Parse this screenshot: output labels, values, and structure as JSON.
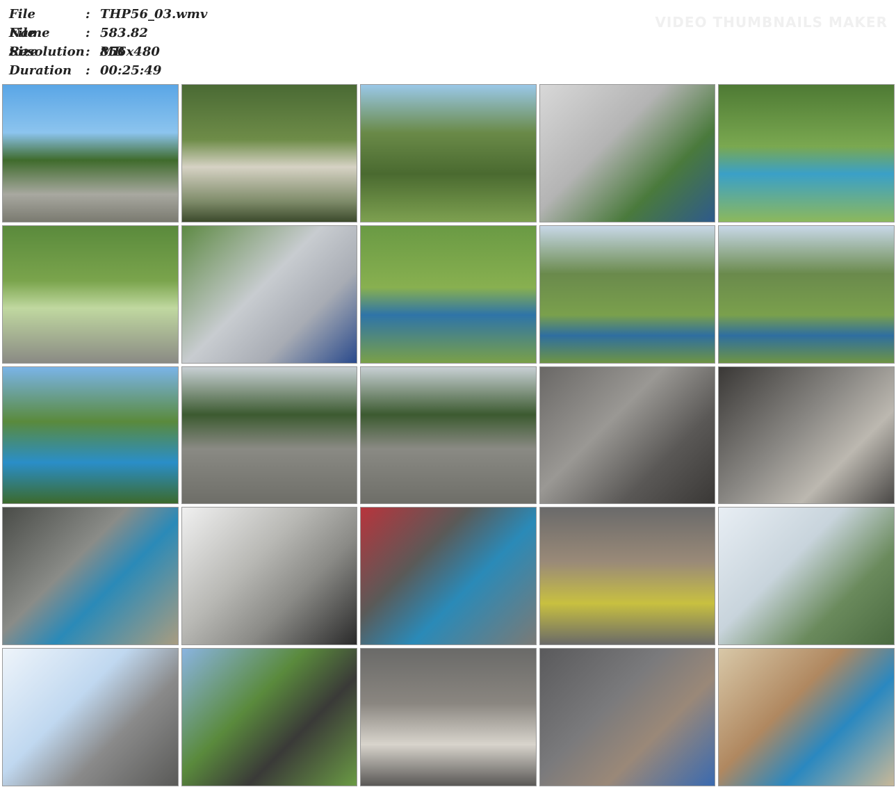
{
  "file_info": {
    "name_label": "File Name",
    "name_colon": ":",
    "name_value": "THP56_03.wmv",
    "size_label": "File Size",
    "size_colon": ":",
    "size_value": "583.82 MB",
    "resolution_label": "Resolution",
    "resolution_colon": ":",
    "resolution_value": "856x480",
    "duration_label": "Duration",
    "duration_colon": ":",
    "duration_value": "00:25:49"
  },
  "watermark": "VIDEO THUMBNAILS MAKER",
  "thumbnail_count": 25,
  "colors": {
    "background": "#ffffff",
    "info_text": "#222222",
    "thumb_border": "#999999"
  }
}
